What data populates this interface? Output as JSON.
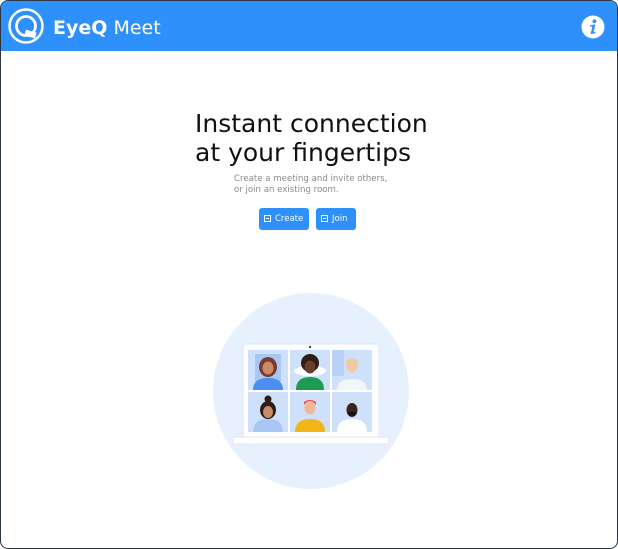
{
  "app": {
    "title_bold": "EyeQ",
    "title_rest": " Meet",
    "info_icon": "info-icon",
    "logo_icon": "eyeq-logo-icon"
  },
  "hero": {
    "headline_line1": "Instant connection",
    "headline_line2": "at your fingertips",
    "subtitle_line1": "Create a meeting and invite others,",
    "subtitle_line2": "or join an existing room."
  },
  "actions": {
    "create_label": "Create",
    "join_label": "Join",
    "create_icon": "plus-box-icon",
    "join_icon": "enter-box-icon"
  },
  "illustration": {
    "name": "video-call-grid-illustration"
  },
  "colors": {
    "accent": "#2d90fb",
    "window_border": "#2c3640",
    "headline": "#111111",
    "subtitle": "#8a8a8a",
    "illustration_circle": "#e7f0fd"
  }
}
